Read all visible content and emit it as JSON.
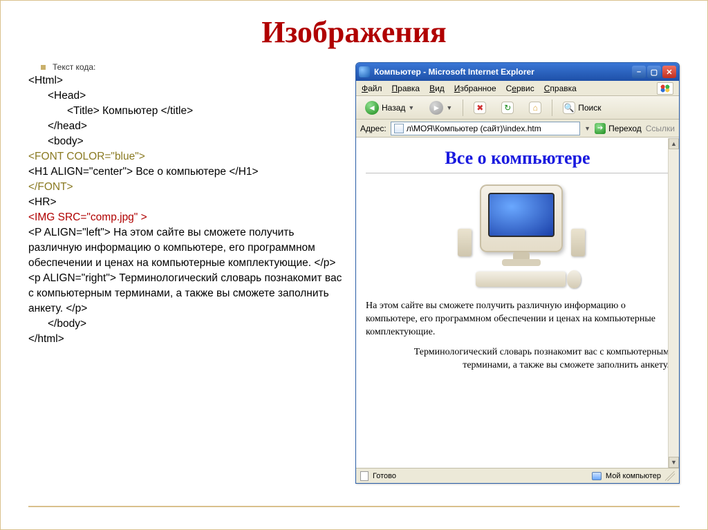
{
  "slide": {
    "title": "Изображения",
    "bullet_label": "Текст кода:"
  },
  "code": {
    "l1": "<Html>",
    "l2": "<Head>",
    "l3": "<Title> Компьютер </title>",
    "l4": "</head>",
    "l5": "<body>",
    "l6": "<FONT COLOR=\"blue\">",
    "l7": "<H1 ALIGN=\"center\"> Все о компьютере </H1>",
    "l8": "</FONT>",
    "l9": "<HR>",
    "l10": "<IMG SRC=\"comp.jpg\" >",
    "l11": "<P ALIGN=\"left\"> На этом сайте вы сможете получить различную информацию о компьютере, его программном обеспечении и ценах на компьютерные комплектующие. </p>",
    "l12": "<p ALIGN=\"right\"> Терминологический словарь познакомит вас с компьютерным терминами, а также вы сможете заполнить анкету. </p>",
    "l13": "</body>",
    "l14": "</html>"
  },
  "ie": {
    "title": "Компьютер - Microsoft Internet Explorer",
    "menu": {
      "file": "Файл",
      "edit": "Правка",
      "view": "Вид",
      "fav": "Избранное",
      "tools": "Сервис",
      "help": "Справка"
    },
    "toolbar": {
      "back": "Назад",
      "search": "Поиск"
    },
    "address": {
      "label": "Адрес:",
      "value": "л\\МОЯ\\Компьютер (сайт)\\index.htm",
      "go": "Переход",
      "links": "Ссылки"
    },
    "page": {
      "h1": "Все о компьютере",
      "p1": "На этом сайте вы сможете получить различную информацию о компьютере, его программном обеспечении и ценах на компьютерные комплектующие.",
      "p2": "Терминологический словарь познакомит вас с компьютерным терминами, а также вы сможете заполнить анкету."
    },
    "status": {
      "ready": "Готово",
      "zone": "Мой компьютер"
    }
  }
}
